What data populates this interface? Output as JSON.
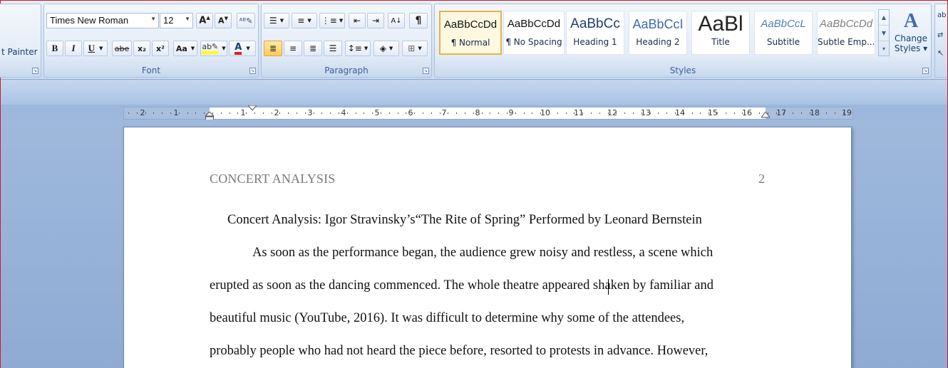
{
  "clipboard": {
    "format_painter_label": "t Painter"
  },
  "font": {
    "name": "Times New Roman",
    "size": "12",
    "group_label": "Font",
    "bold": "B",
    "italic": "I",
    "underline": "U",
    "strike": "abe",
    "subscript": "x₂",
    "superscript": "x²",
    "change_case": "Aa",
    "highlight_color": "#ffff00",
    "font_color": "#e02020"
  },
  "paragraph": {
    "group_label": "Paragraph"
  },
  "styles": {
    "group_label": "Styles",
    "items": [
      {
        "sample": "AaBbCcDd",
        "name": "¶ Normal"
      },
      {
        "sample": "AaBbCcDd",
        "name": "¶ No Spacing"
      },
      {
        "sample": "AaBbCc",
        "name": "Heading 1"
      },
      {
        "sample": "AaBbCcI",
        "name": "Heading 2"
      },
      {
        "sample": "AaBl",
        "name": "Title"
      },
      {
        "sample": "AaBbCcL",
        "name": "Subtitle"
      },
      {
        "sample": "AaBbCcDd",
        "name": "Subtle Emp..."
      }
    ],
    "change_styles_label_1": "Change",
    "change_styles_label_2": "Styles ▾"
  },
  "ruler": {
    "left_numbers": [
      "2",
      "1"
    ],
    "right_numbers": [
      "1",
      "2",
      "3",
      "4",
      "5",
      "6",
      "7",
      "8",
      "9",
      "10",
      "11",
      "12",
      "13",
      "14",
      "15",
      "16",
      "17",
      "18",
      "19"
    ]
  },
  "document": {
    "header": "CONCERT ANALYSIS",
    "page_number": "2",
    "title": "Concert Analysis: Igor Stravinsky’s“The Rite of Spring” Performed by Leonard Bernstein",
    "lines": [
      "As soon as the performance began, the audience grew noisy and restless, a scene which",
      "erupted as soon as the dancing commenced. The whole theatre appeared shaken by familiar and",
      "beautiful music (YouTube, 2016). It was difficult to determine why some of the attendees,",
      "probably people who had not heard the piece before, resorted to protests in advance. However,"
    ]
  }
}
